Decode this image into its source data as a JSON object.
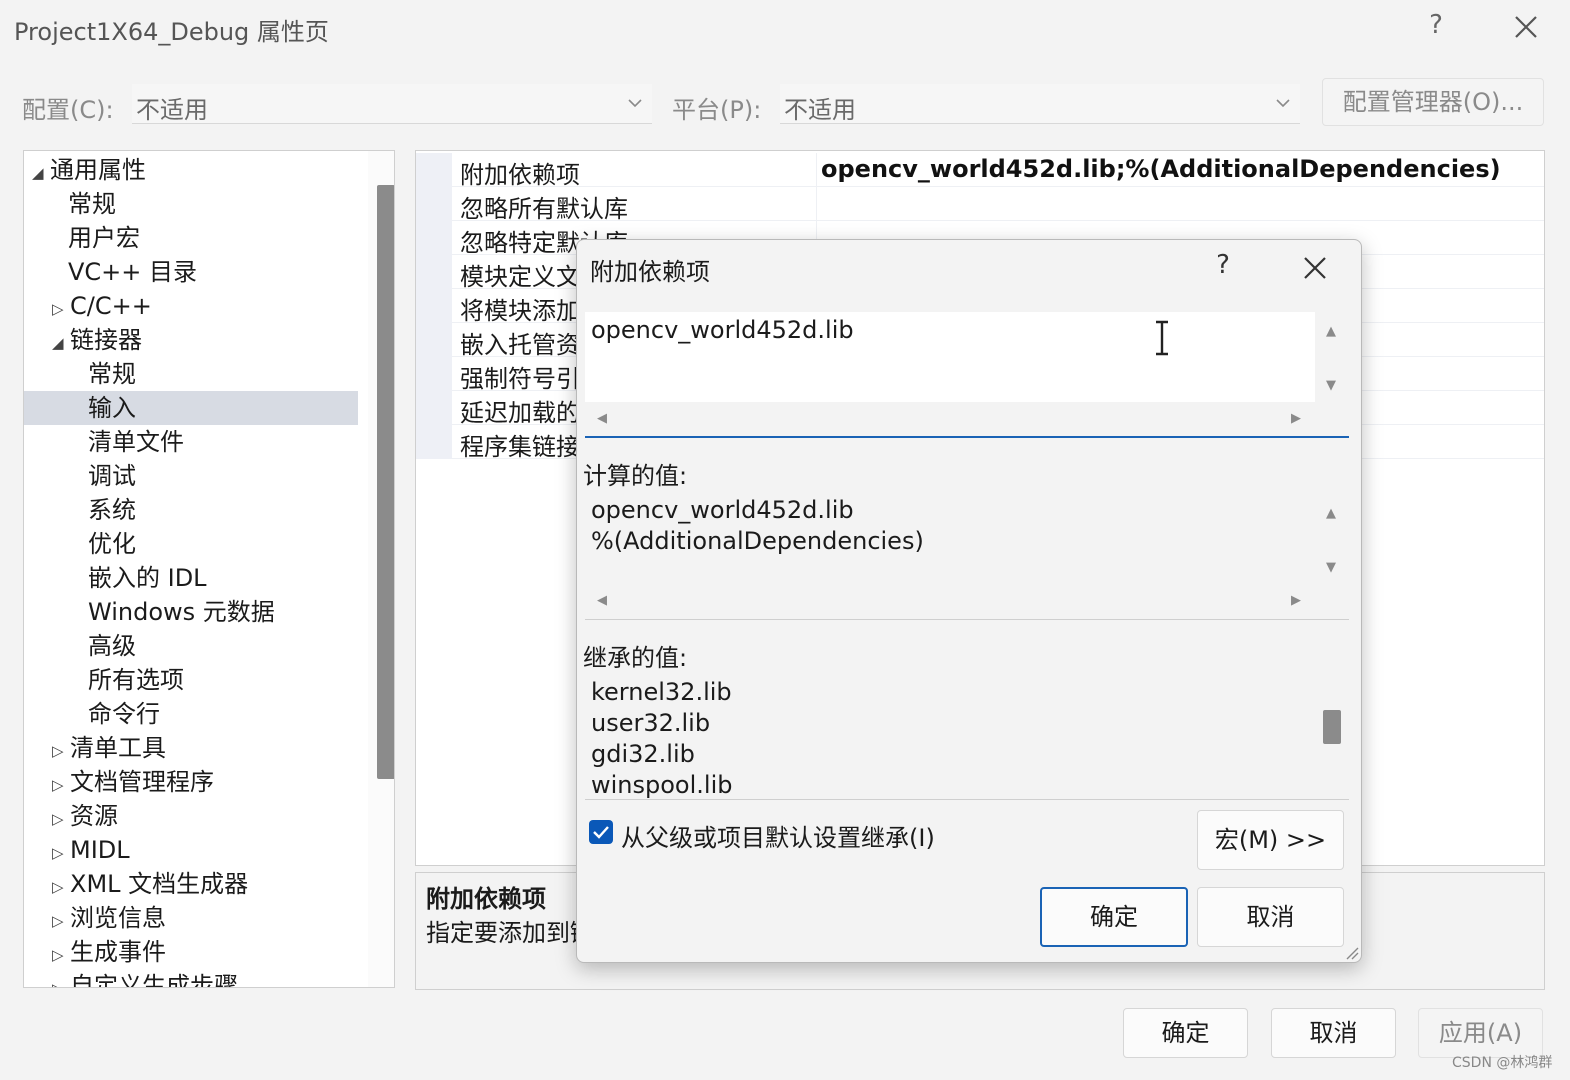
{
  "window": {
    "title": "Project1X64_Debug 属性页",
    "help": "?"
  },
  "config": {
    "config_label": "配置(C):",
    "config_value": "不适用",
    "platform_label": "平台(P):",
    "platform_value": "不适用",
    "manager_button": "配置管理器(O)..."
  },
  "tree": {
    "items": [
      {
        "label": "通用属性",
        "arrow": "◢"
      },
      {
        "label": "常规",
        "arrow": ""
      },
      {
        "label": "用户宏",
        "arrow": ""
      },
      {
        "label": "VC++ 目录",
        "arrow": ""
      },
      {
        "label": "C/C++",
        "arrow": "▷"
      },
      {
        "label": "链接器",
        "arrow": "◢"
      },
      {
        "label": "常规",
        "arrow": ""
      },
      {
        "label": "输入",
        "arrow": ""
      },
      {
        "label": "清单文件",
        "arrow": ""
      },
      {
        "label": "调试",
        "arrow": ""
      },
      {
        "label": "系统",
        "arrow": ""
      },
      {
        "label": "优化",
        "arrow": ""
      },
      {
        "label": "嵌入的 IDL",
        "arrow": ""
      },
      {
        "label": "Windows 元数据",
        "arrow": ""
      },
      {
        "label": "高级",
        "arrow": ""
      },
      {
        "label": "所有选项",
        "arrow": ""
      },
      {
        "label": "命令行",
        "arrow": ""
      },
      {
        "label": "清单工具",
        "arrow": "▷"
      },
      {
        "label": "文档管理程序",
        "arrow": "▷"
      },
      {
        "label": "资源",
        "arrow": "▷"
      },
      {
        "label": "MIDL",
        "arrow": "▷"
      },
      {
        "label": "XML 文档生成器",
        "arrow": "▷"
      },
      {
        "label": "浏览信息",
        "arrow": "▷"
      },
      {
        "label": "生成事件",
        "arrow": "▷"
      },
      {
        "label": "自定义生成步骤",
        "arrow": "▷"
      }
    ]
  },
  "grid": {
    "rows": [
      {
        "name": "附加依赖项",
        "value": "opencv_world452d.lib;%(AdditionalDependencies)"
      },
      {
        "name": "忽略所有默认库",
        "value": ""
      },
      {
        "name": "忽略特定默认库",
        "value": ""
      },
      {
        "name": "模块定义文",
        "value": ""
      },
      {
        "name": "将模块添加",
        "value": ""
      },
      {
        "name": "嵌入托管资",
        "value": ""
      },
      {
        "name": "强制符号引",
        "value": ""
      },
      {
        "name": "延迟加载的",
        "value": ""
      },
      {
        "name": "程序集链接",
        "value": ""
      }
    ]
  },
  "desc": {
    "title": "附加依赖项",
    "text": "指定要添加到链"
  },
  "dialog": {
    "title": "附加依赖项",
    "help": "?",
    "edit_text": "opencv_world452d.lib",
    "computed_label": "计算的值:",
    "computed_lines": [
      "opencv_world452d.lib",
      "%(AdditionalDependencies)"
    ],
    "inherited_label": "继承的值:",
    "inherited_lines": [
      "kernel32.lib",
      "user32.lib",
      "gdi32.lib",
      "winspool.lib"
    ],
    "inherit_checkbox": "从父级或项目默认设置继承(I)",
    "macro_button": "宏(M) >>",
    "ok_button": "确定",
    "cancel_button": "取消"
  },
  "footer": {
    "ok": "确定",
    "cancel": "取消",
    "apply": "应用(A)"
  },
  "watermark": "CSDN @林鸿群"
}
